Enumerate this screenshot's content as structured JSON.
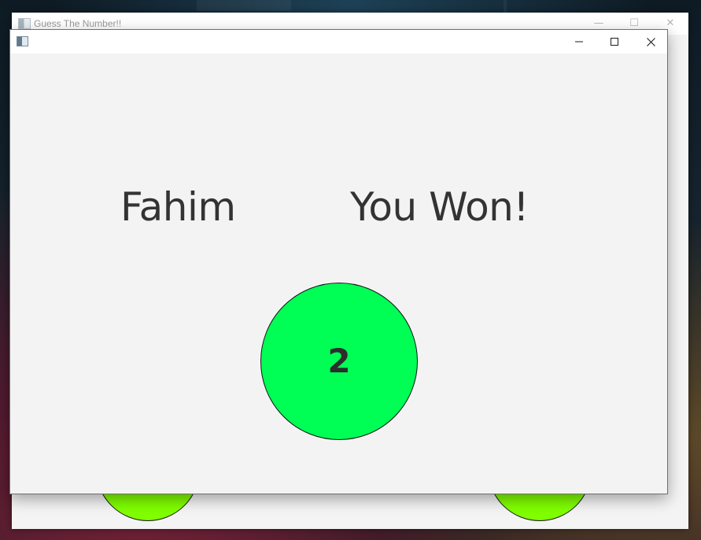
{
  "back_window": {
    "title": "Guess The Number!!",
    "controls": {
      "minimize": "—",
      "maximize": "☐",
      "close": "✕"
    },
    "circle_color": "#80ff00"
  },
  "front_window": {
    "title": "",
    "player_name": "Fahim",
    "result": "You Won!",
    "number": "2",
    "circle_color": "#00ff55",
    "background": "#f3f3f3"
  }
}
